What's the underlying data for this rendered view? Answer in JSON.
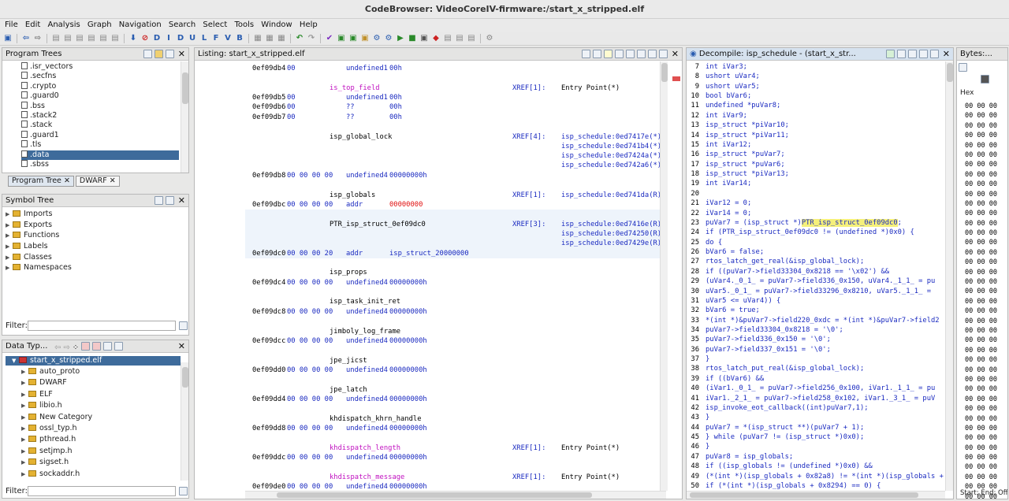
{
  "window_title": "CodeBrowser: VideoCoreIV-firmware:/start_x_stripped.elf",
  "menu": [
    "File",
    "Edit",
    "Analysis",
    "Graph",
    "Navigation",
    "Search",
    "Select",
    "Tools",
    "Window",
    "Help"
  ],
  "program_trees": {
    "title": "Program Trees",
    "items": [
      ".isr_vectors",
      ".secfns",
      ".crypto",
      ".guard0",
      ".bss",
      ".stack2",
      ".stack",
      ".guard1",
      ".tls",
      ".data",
      ".sbss"
    ],
    "selected": ".data",
    "tabs": [
      "Program Tree",
      "DWARF"
    ]
  },
  "symbol_tree": {
    "title": "Symbol Tree",
    "items": [
      "Imports",
      "Exports",
      "Functions",
      "Labels",
      "Classes",
      "Namespaces"
    ],
    "filter_label": "Filter:"
  },
  "data_types": {
    "title": "Data Typ...",
    "root": "start_x_stripped.elf",
    "items": [
      "auto_proto",
      "DWARF",
      "ELF",
      "libio.h",
      "New Category",
      "ossl_typ.h",
      "pthread.h",
      "setjmp.h",
      "sigset.h",
      "sockaddr.h"
    ],
    "filter_label": "Filter:"
  },
  "listing": {
    "title": "Listing:  start_x_stripped.elf",
    "rows": [
      {
        "t": "data",
        "addr": "0ef09db4",
        "bytes": "00",
        "mnem": "undefined1",
        "opnd": "00h"
      },
      {
        "t": "label",
        "name": "is_top_field",
        "xr": true,
        "xrefh": "XREF[1]:",
        "xref": "Entry Point(*)"
      },
      {
        "t": "data",
        "addr": "0ef09db5",
        "bytes": "00",
        "mnem": "undefined1",
        "opnd": "00h"
      },
      {
        "t": "data",
        "addr": "0ef09db6",
        "bytes": "00",
        "mnem": "??",
        "opnd": "00h"
      },
      {
        "t": "data",
        "addr": "0ef09db7",
        "bytes": "00",
        "mnem": "??",
        "opnd": "00h"
      },
      {
        "t": "label",
        "name": "isp_global_lock",
        "xrefh": "XREF[4]:",
        "xref": "isp_schedule:0ed7417e(*),"
      },
      {
        "t": "xref",
        "xref": "isp_schedule:0ed741b4(*),"
      },
      {
        "t": "xref",
        "xref": "isp_schedule:0ed7424a(*),"
      },
      {
        "t": "xref",
        "xref": "isp_schedule:0ed742a6(*)"
      },
      {
        "t": "data",
        "addr": "0ef09db8",
        "bytes": "00 00 00 00",
        "mnem": "undefined4",
        "opnd": "00000000h"
      },
      {
        "t": "label",
        "name": "isp_globals",
        "xrefh": "XREF[1]:",
        "xref": "isp_schedule:0ed741da(R)"
      },
      {
        "t": "data",
        "addr": "0ef09dbc",
        "bytes": "00 00 00 00",
        "mnem": "addr",
        "opnd": "00000000",
        "red": true
      },
      {
        "t": "label",
        "name": "PTR_isp_struct_0ef09dc0",
        "xrefh": "XREF[3]:",
        "xref": "isp_schedule:0ed7416e(R),"
      },
      {
        "t": "xref",
        "xref": "isp_schedule:0ed74250(R),"
      },
      {
        "t": "xref",
        "xref": "isp_schedule:0ed7429e(R)"
      },
      {
        "t": "data",
        "addr": "0ef09dc0",
        "bytes": "00 00 00 20",
        "mnem": "addr",
        "opnd": "isp_struct_20000000"
      },
      {
        "t": "label",
        "name": "isp_props"
      },
      {
        "t": "data",
        "addr": "0ef09dc4",
        "bytes": "00 00 00 00",
        "mnem": "undefined4",
        "opnd": "00000000h"
      },
      {
        "t": "label",
        "name": "isp_task_init_ret"
      },
      {
        "t": "data",
        "addr": "0ef09dc8",
        "bytes": "00 00 00 00",
        "mnem": "undefined4",
        "opnd": "00000000h"
      },
      {
        "t": "label",
        "name": "jimboly_log_frame"
      },
      {
        "t": "data",
        "addr": "0ef09dcc",
        "bytes": "00 00 00 00",
        "mnem": "undefined4",
        "opnd": "00000000h"
      },
      {
        "t": "label",
        "name": "jpe_jicst"
      },
      {
        "t": "data",
        "addr": "0ef09dd0",
        "bytes": "00 00 00 00",
        "mnem": "undefined4",
        "opnd": "00000000h"
      },
      {
        "t": "label",
        "name": "jpe_latch"
      },
      {
        "t": "data",
        "addr": "0ef09dd4",
        "bytes": "00 00 00 00",
        "mnem": "undefined4",
        "opnd": "00000000h"
      },
      {
        "t": "label",
        "name": "khdispatch_khrn_handle"
      },
      {
        "t": "data",
        "addr": "0ef09dd8",
        "bytes": "00 00 00 00",
        "mnem": "undefined4",
        "opnd": "00000000h"
      },
      {
        "t": "label",
        "name": "khdispatch_length",
        "xr": true,
        "xrefh": "XREF[1]:",
        "xref": "Entry Point(*)"
      },
      {
        "t": "data",
        "addr": "0ef09ddc",
        "bytes": "00 00 00 00",
        "mnem": "undefined4",
        "opnd": "00000000h"
      },
      {
        "t": "label",
        "name": "khdispatch_message",
        "xr": true,
        "xrefh": "XREF[1]:",
        "xref": "Entry Point(*)"
      },
      {
        "t": "data",
        "addr": "0ef09de0",
        "bytes": "00 00 00 00",
        "mnem": "undefined4",
        "opnd": "00000000h"
      }
    ]
  },
  "decompile": {
    "title": "Decompile: isp_schedule -  (start_x_str...",
    "lines": [
      [
        "7",
        "int iVar3;"
      ],
      [
        "8",
        "ushort uVar4;"
      ],
      [
        "9",
        "ushort uVar5;"
      ],
      [
        "10",
        "bool bVar6;"
      ],
      [
        "11",
        "undefined *puVar8;"
      ],
      [
        "12",
        "int iVar9;"
      ],
      [
        "13",
        "isp_struct *piVar10;"
      ],
      [
        "14",
        "isp_struct *piVar11;"
      ],
      [
        "15",
        "int iVar12;"
      ],
      [
        "16",
        "isp_struct *puVar7;"
      ],
      [
        "17",
        "isp_struct *puVar6;"
      ],
      [
        "18",
        "isp_struct *piVar13;"
      ],
      [
        "19",
        "int iVar14;"
      ],
      [
        "20",
        ""
      ],
      [
        "21",
        "iVar12 = 0;"
      ],
      [
        "22",
        "iVar14 = 0;"
      ],
      [
        "23",
        "puVar7 = (isp_struct *)PTR_isp_struct_0ef09dc0;"
      ],
      [
        "24",
        "if (PTR_isp_struct_0ef09dc0 != (undefined *)0x0) {"
      ],
      [
        "25",
        "  do {"
      ],
      [
        "26",
        "    bVar6 = false;"
      ],
      [
        "27",
        "    rtos_latch_get_real(&isp_global_lock);"
      ],
      [
        "28",
        "    if ((puVar7->field33304_0x8218 == '\\x02') &&"
      ],
      [
        "29",
        "       (uVar4._0_1_ = puVar7->field336_0x150, uVar4._1_1_ = pu"
      ],
      [
        "30",
        "       uVar5._0_1_ = puVar7->field33296_0x8210, uVar5._1_1_ ="
      ],
      [
        "31",
        "       uVar5 <= uVar4)) {"
      ],
      [
        "32",
        "      bVar6 = true;"
      ],
      [
        "33",
        "      *(int *)&puVar7->field220_0xdc = *(int *)&puVar7->field2"
      ],
      [
        "34",
        "      puVar7->field33304_0x8218 = '\\0';"
      ],
      [
        "35",
        "      puVar7->field336_0x150 = '\\0';"
      ],
      [
        "36",
        "      puVar7->field337_0x151 = '\\0';"
      ],
      [
        "37",
        "    }"
      ],
      [
        "38",
        "    rtos_latch_put_real(&isp_global_lock);"
      ],
      [
        "39",
        "    if ((bVar6) &&"
      ],
      [
        "40",
        "       (iVar1._0_1_ = puVar7->field256_0x100, iVar1._1_1_ = pu"
      ],
      [
        "41",
        "       iVar1._2_1_ = puVar7->field258_0x102, iVar1._3_1_ = puV"
      ],
      [
        "42",
        "      isp_invoke_eot_callback((int)puVar7,1);"
      ],
      [
        "43",
        "    }"
      ],
      [
        "44",
        "    puVar7 = *(isp_struct **)(puVar7 + 1);"
      ],
      [
        "45",
        "  } while (puVar7 != (isp_struct *)0x0);"
      ],
      [
        "46",
        "}"
      ],
      [
        "47",
        "puVar8 = isp_globals;"
      ],
      [
        "48",
        "if ((isp_globals != (undefined *)0x0) &&"
      ],
      [
        "49",
        "   (*(int *)(isp_globals + 0x82a8) != *(int *)(isp_globals + 0"
      ],
      [
        "50",
        "  if (*(int *)(isp_globals + 0x8294) == 0) {"
      ]
    ],
    "highlight": "PTR_isp_struct_0ef09dc0"
  },
  "bytes": {
    "title": "Bytes:...",
    "col": "Hex",
    "cell": "00 00 00",
    "rows": 42,
    "footer": "Start:   End:   Offs"
  }
}
